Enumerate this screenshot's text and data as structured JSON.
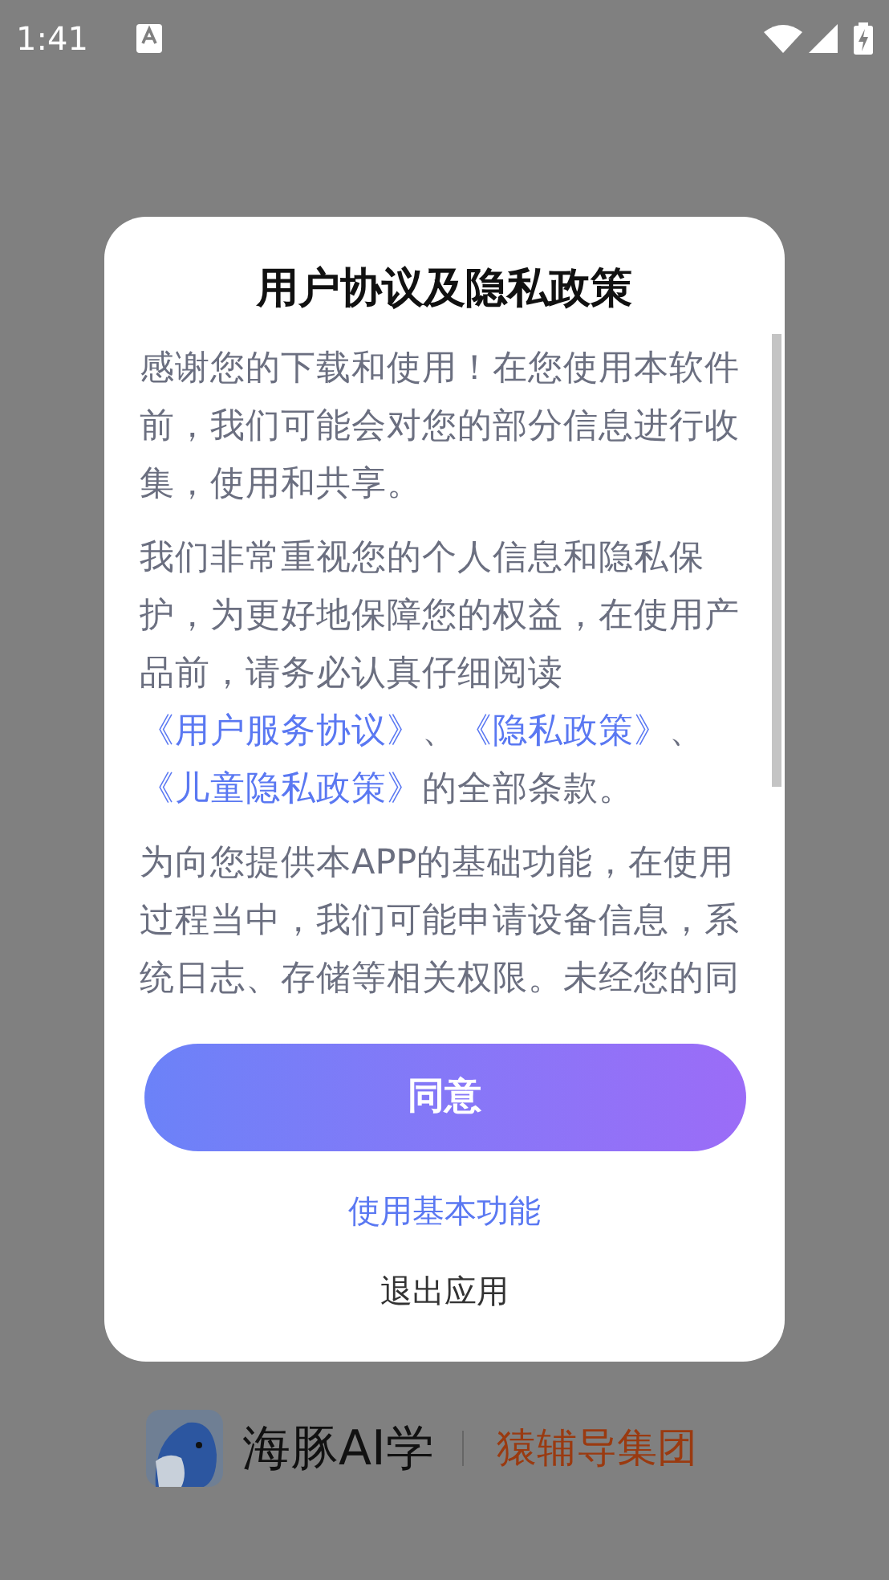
{
  "status_bar": {
    "time": "1:41"
  },
  "dialog": {
    "title": "用户协议及隐私政策",
    "paragraphs": [
      [
        {
          "kind": "text",
          "text": "感谢您的下载和使用！在您使用本软件前，我们可能会对您的部分信息进行收集，使用和共享。"
        }
      ],
      [
        {
          "kind": "text",
          "text": "我们非常重视您的个人信息和隐私保护，为更好地保障您的权益，在使用产品前，请务必认真仔细阅读"
        },
        {
          "kind": "link",
          "text": "《用户服务协议》"
        },
        {
          "kind": "text",
          "text": "、"
        },
        {
          "kind": "link",
          "text": "《隐私政策》"
        },
        {
          "kind": "text",
          "text": "、"
        },
        {
          "kind": "link",
          "text": "《儿童隐私政策》"
        },
        {
          "kind": "text",
          "text": "的全部条款。"
        }
      ],
      [
        {
          "kind": "text",
          "text": "为向您提供本APP的基础功能，在使用过程当中，我们可能申请设备信息，系统日志、存储等相关权限。未经您的同"
        }
      ]
    ],
    "buttons": [
      {
        "label": "同意",
        "kind": "primary"
      },
      {
        "label": "使用基本功能",
        "kind": "link"
      },
      {
        "label": "退出应用",
        "kind": "plain"
      }
    ]
  },
  "branding": {
    "app_name": "海豚AI学",
    "company": "猿辅导集团"
  }
}
